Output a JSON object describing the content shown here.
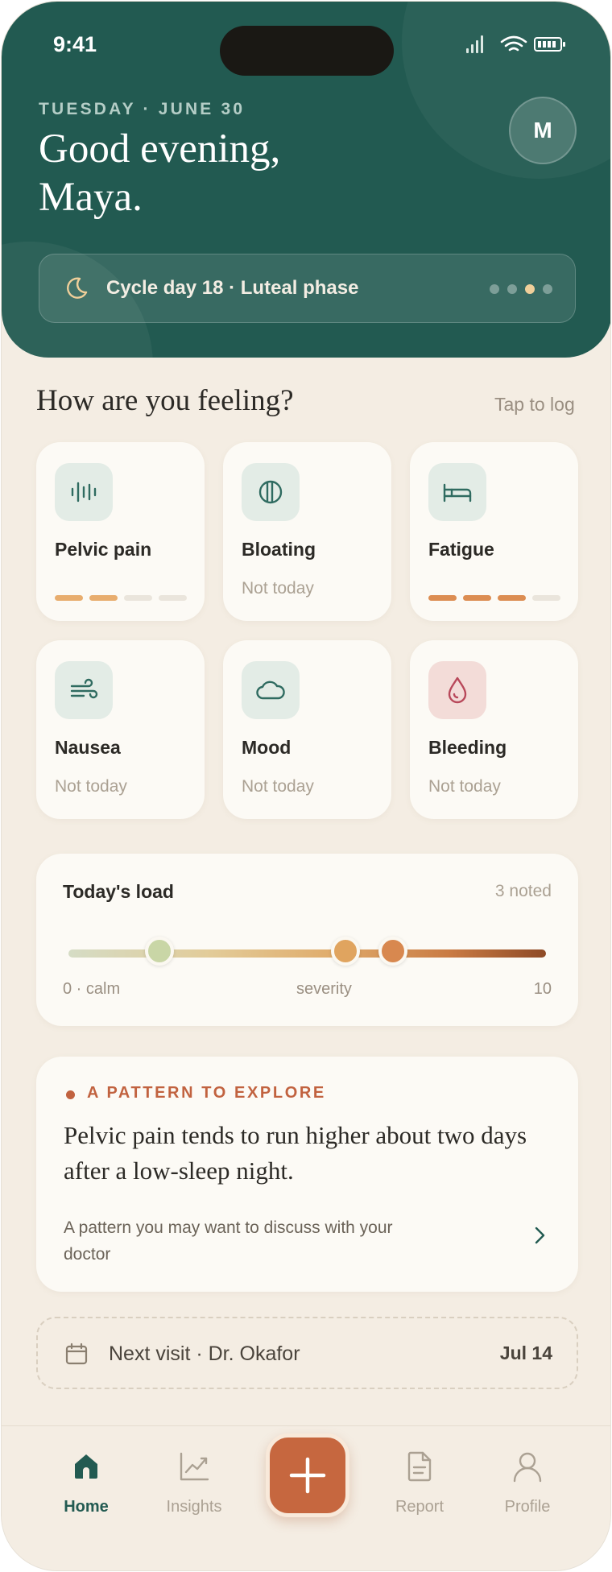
{
  "status_bar": {
    "time": "9:41"
  },
  "header": {
    "date": "TUESDAY · JUNE 30",
    "greeting_line1": "Good evening,",
    "greeting_line2": "Maya.",
    "avatar_initial": "M",
    "cycle_text": "Cycle day 18 · Luteal phase",
    "cycle_dots": {
      "count": 4,
      "active_index": 2
    }
  },
  "feelings": {
    "title": "How are you feeling?",
    "tap_label": "Tap to log",
    "symptoms": [
      {
        "label": "Pelvic pain",
        "icon": "waveform-icon",
        "status": "",
        "severity_level": 2,
        "severity_max": 4
      },
      {
        "label": "Bloating",
        "icon": "bloating-circle-icon",
        "status": "Not today"
      },
      {
        "label": "Fatigue",
        "icon": "bed-icon",
        "status": "",
        "severity_level": 3,
        "severity_max": 4
      },
      {
        "label": "Nausea",
        "icon": "wind-icon",
        "status": "Not today"
      },
      {
        "label": "Mood",
        "icon": "cloud-icon",
        "status": "Not today"
      },
      {
        "label": "Bleeding",
        "icon": "drop-icon",
        "status": "Not today"
      }
    ]
  },
  "load": {
    "title": "Today's load",
    "noted": "3 noted",
    "min_label": "0 · calm",
    "mid_label": "severity",
    "max_label": "10",
    "scale_max": 10,
    "markers": [
      1.9,
      5.8,
      6.8
    ]
  },
  "pattern": {
    "label": "A PATTERN TO EXPLORE",
    "body": "Pelvic pain tends to run higher about two days after a low-sleep night.",
    "note": "A pattern you may want to discuss with your doctor"
  },
  "visit": {
    "text": "Next visit · Dr. Okafor",
    "date": "Jul 14"
  },
  "tabs": [
    {
      "label": "Home",
      "icon": "home-icon",
      "active": true
    },
    {
      "label": "Insights",
      "icon": "chart-icon",
      "active": false
    },
    {
      "label": "Report",
      "icon": "document-icon",
      "active": false
    },
    {
      "label": "Profile",
      "icon": "person-icon",
      "active": false
    }
  ],
  "colors": {
    "header_green": "#225a51",
    "accent_orange": "#c6673f",
    "background": "#f4ede3",
    "card": "#fcfaf5"
  }
}
